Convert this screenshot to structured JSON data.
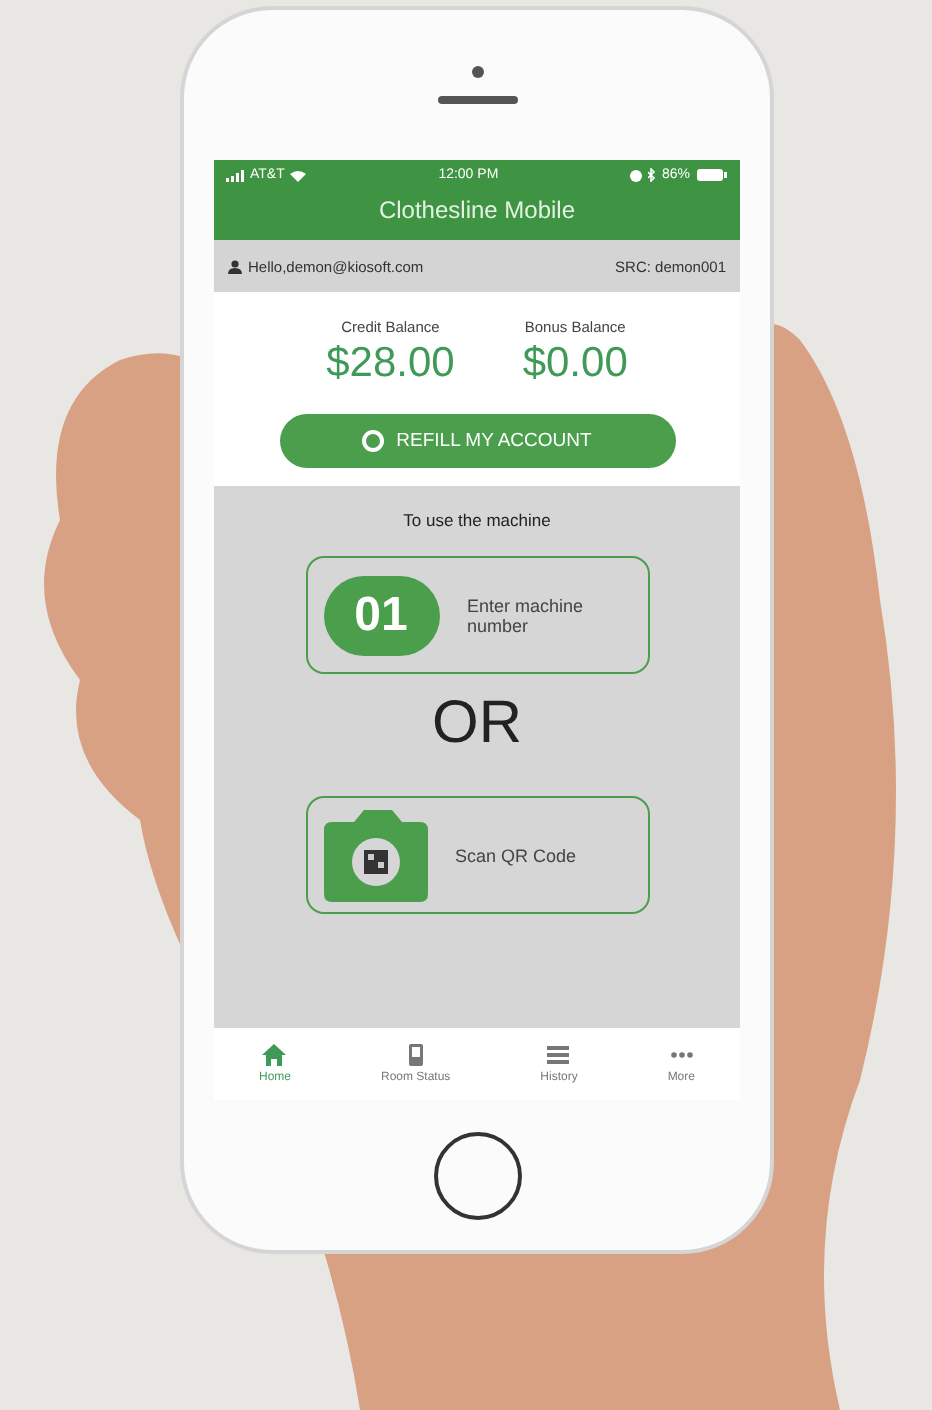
{
  "status_bar": {
    "carrier": "AT&T",
    "time": "12:00 PM",
    "battery": "86%"
  },
  "title": "Clothesline Mobile",
  "user_bar": {
    "greeting": "Hello,demon@kiosoft.com",
    "src": "SRC: demon001"
  },
  "balances": [
    {
      "label": "Credit Balance",
      "amount": "$28.00"
    },
    {
      "label": "Bonus Balance",
      "amount": "$0.00"
    }
  ],
  "refill_button": "REFILL MY ACCOUNT",
  "machine_section": {
    "prompt": "To use the machine",
    "separator": "OR",
    "options": [
      {
        "kind": "number",
        "badge": "01",
        "label": "Enter machine number"
      },
      {
        "kind": "qr",
        "label": "Scan QR Code"
      }
    ]
  },
  "tabs": [
    {
      "kind": "home",
      "label": "Home",
      "selected": true
    },
    {
      "kind": "room",
      "label": "Room Status",
      "selected": false
    },
    {
      "kind": "history",
      "label": "History",
      "selected": false
    },
    {
      "kind": "more",
      "label": "More",
      "selected": false
    }
  ]
}
